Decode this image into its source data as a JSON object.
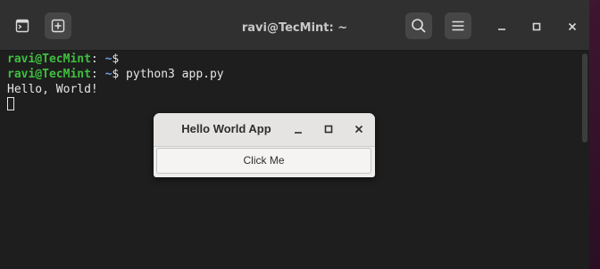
{
  "terminal": {
    "title": "ravi@TecMint: ~",
    "lines": [
      {
        "user": "ravi@TecMint",
        "sep": ":",
        "path": " ~",
        "prompt": "$",
        "command": ""
      },
      {
        "user": "ravi@TecMint",
        "sep": ":",
        "path": " ~",
        "prompt": "$",
        "command": " python3 app.py"
      }
    ],
    "output": "Hello, World!"
  },
  "dialog": {
    "title": "Hello World App",
    "button_label": "Click Me"
  },
  "icons": {
    "terminal": "terminal-icon",
    "new_tab": "new-tab-icon",
    "search": "search-icon",
    "menu": "hamburger-menu-icon",
    "minimize": "minimize-icon",
    "maximize": "maximize-icon",
    "close": "close-icon"
  },
  "colors": {
    "prompt_user": "#3fbf3f",
    "prompt_path": "#6e9be0",
    "terminal_bg": "#1e1e1e",
    "desktop_bg": "#5e1f43"
  }
}
